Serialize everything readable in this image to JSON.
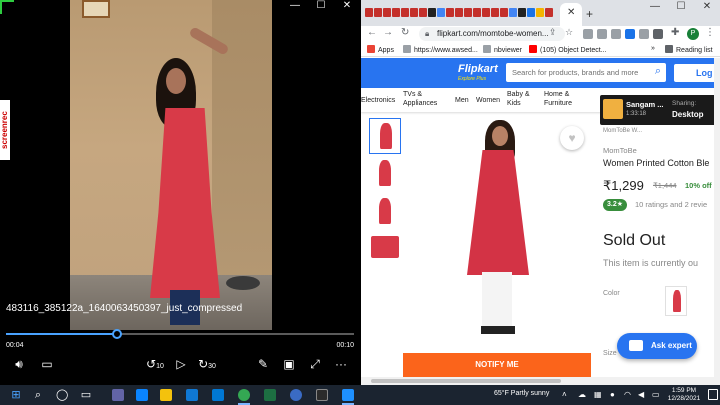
{
  "player": {
    "window_controls": [
      "—",
      "☐",
      "✕"
    ],
    "recorder_badge": "screenrec",
    "video_title": "483116_385122a_1640063450397_just_compressed",
    "time_current": "00:04",
    "time_total": "00:10",
    "progress_fraction": 0.32,
    "rewind_label": "10",
    "forward_label": "30",
    "more_label": "···"
  },
  "browser": {
    "tab_close": "✕",
    "new_tab": "+",
    "window_controls": [
      "—",
      "☐",
      "✕"
    ],
    "url": "flipkart.com/momtobe-women...",
    "profile_initial": "P",
    "bookmarks": [
      {
        "label": "Apps"
      },
      {
        "label": "https://www.awsed..."
      },
      {
        "label": "nbviewer"
      },
      {
        "label": "(105) Object Detect..."
      }
    ],
    "bookmarks_more": "»",
    "reading_list": "Reading list"
  },
  "flipkart": {
    "logo": "Flipkart",
    "tagline": "Explore Plus",
    "search_placeholder": "Search for products, brands and more",
    "login_label": "Log",
    "categories": [
      {
        "line1": "Electronics",
        "line2": ""
      },
      {
        "line1": "TVs &",
        "line2": "Appliances"
      },
      {
        "line1": "Men",
        "line2": ""
      },
      {
        "line1": "Women",
        "line2": ""
      },
      {
        "line1": "Baby &",
        "line2": "Kids"
      },
      {
        "line1": "Home &",
        "line2": "Furniture"
      }
    ],
    "share_overlay": {
      "name": "Sangam ...",
      "time": "1:33:18",
      "label": "Sharing:",
      "value": "Desktop"
    },
    "breadcrumb": "MomToBe W...",
    "brand": "MomToBe",
    "product_name": "Women Printed Cotton Ble",
    "price": "₹1,299",
    "mrp": "₹1,444",
    "discount": "10% off",
    "rating": "3.2★",
    "rating_count": "10 ratings and 2 revie",
    "sold_out": "Sold Out",
    "sold_out_msg": "This item is currently ou",
    "color_label": "Color",
    "size_label": "Size",
    "notify_label": "NOTIFY ME",
    "ask_expert_label": "Ask expert",
    "accent_color": "#2874f0",
    "notify_color": "#fb641b"
  },
  "taskbar": {
    "weather": "65°F  Partly sunny",
    "time": "1:59 PM",
    "date": "12/28/2021"
  }
}
